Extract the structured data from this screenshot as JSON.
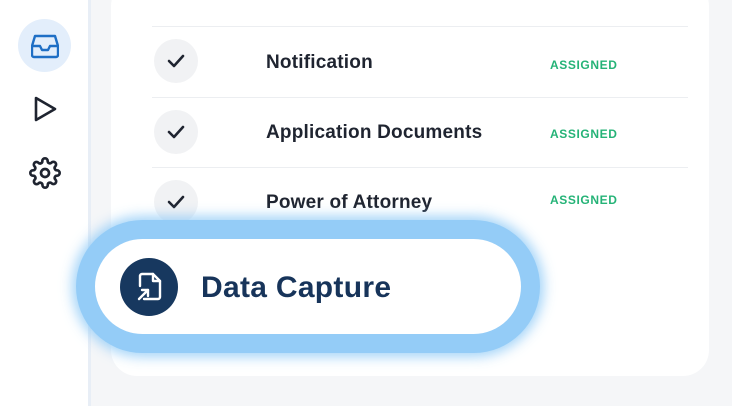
{
  "sidebar": {
    "items": [
      {
        "icon": "inbox-icon",
        "active": true
      },
      {
        "icon": "play-icon",
        "active": false
      },
      {
        "icon": "gear-icon",
        "active": false
      }
    ]
  },
  "checklist": {
    "items": [
      {
        "label": "Notification",
        "status": "ASSIGNED"
      },
      {
        "label": "Application Documents",
        "status": "ASSIGNED"
      },
      {
        "label": "Power of Attorney",
        "status": "ASSIGNED"
      }
    ]
  },
  "highlight": {
    "label": "Data Capture",
    "icon": "document-arrow-icon"
  },
  "colors": {
    "accent": "#1f6fc5",
    "status_green": "#25b377",
    "highlight_glow": "#94ccf7",
    "pill_icon_bg": "#17385f"
  }
}
